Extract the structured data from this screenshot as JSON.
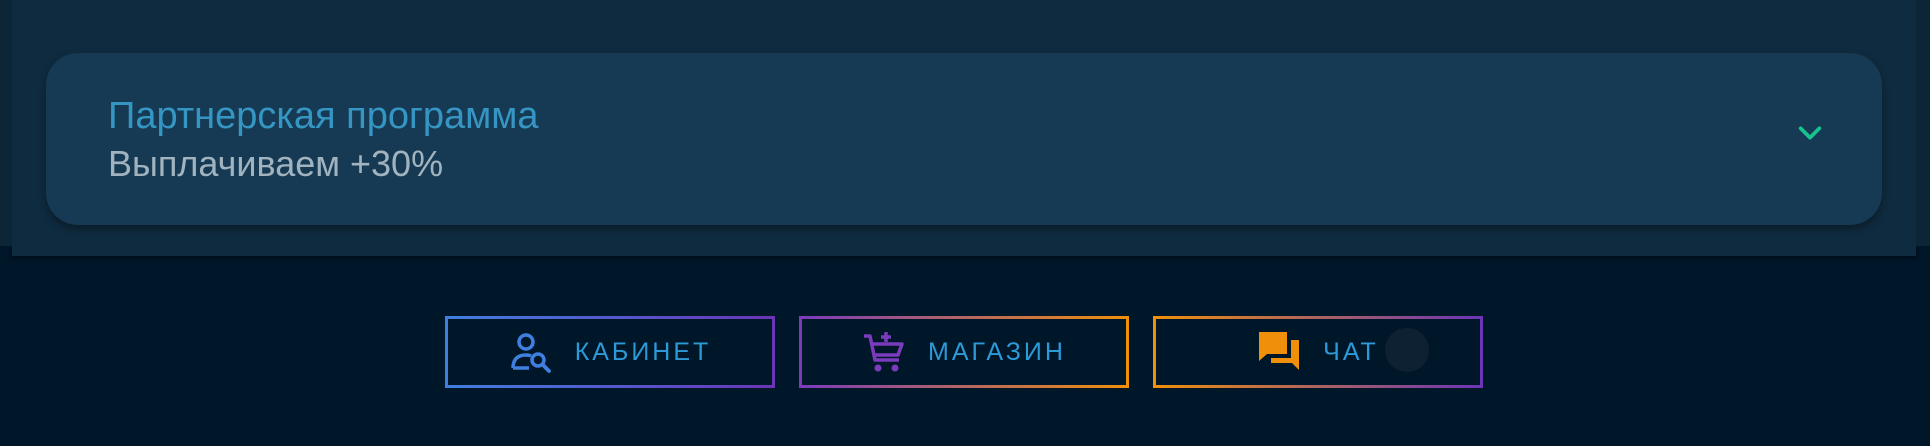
{
  "card": {
    "title": "Партнерская программа",
    "subtitle": "Выплачиваем +30%",
    "chevron_icon": "chevron-down-icon"
  },
  "buttons": [
    {
      "label": "КАБИНЕТ",
      "icon": "user-search-icon",
      "icon_color": "#3f7fe0"
    },
    {
      "label": "МАГАЗИН",
      "icon": "cart-plus-icon",
      "icon_color": "#7b3bbd"
    },
    {
      "label": "ЧАТ",
      "icon": "chat-icon",
      "icon_color": "#f0900a"
    }
  ],
  "colors": {
    "background": "#001629",
    "card": "#163a53",
    "title": "#3596c3",
    "accent_green": "#17c38e",
    "button_text": "#2c9ad7"
  }
}
